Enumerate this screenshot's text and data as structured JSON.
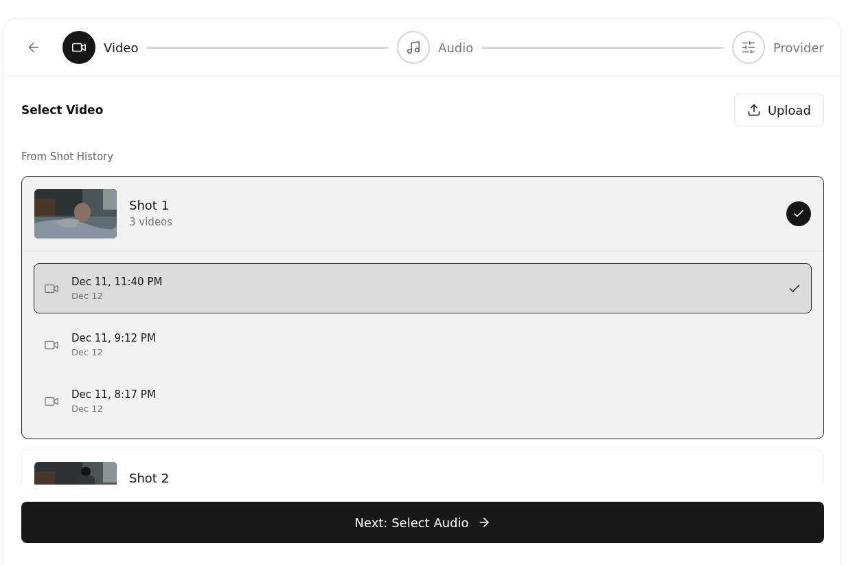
{
  "steps": [
    {
      "label": "Video",
      "selected": true
    },
    {
      "label": "Audio",
      "selected": false
    },
    {
      "label": "Provider",
      "selected": false
    }
  ],
  "section": {
    "title": "Select Video",
    "upload_button": "Upload",
    "history_label": "From Shot History"
  },
  "shots": [
    {
      "title": "Shot 1",
      "subtitle": "3 videos",
      "selected": true,
      "videos": [
        {
          "title": "Dec 11, 11:40 PM",
          "date": "Dec 12",
          "selected": true
        },
        {
          "title": "Dec 11, 9:12 PM",
          "date": "Dec 12",
          "selected": false
        },
        {
          "title": "Dec 11, 8:17 PM",
          "date": "Dec 12",
          "selected": false
        }
      ]
    },
    {
      "title": "Shot 2",
      "selected": false
    }
  ],
  "next_button": "Next: Select Audio"
}
